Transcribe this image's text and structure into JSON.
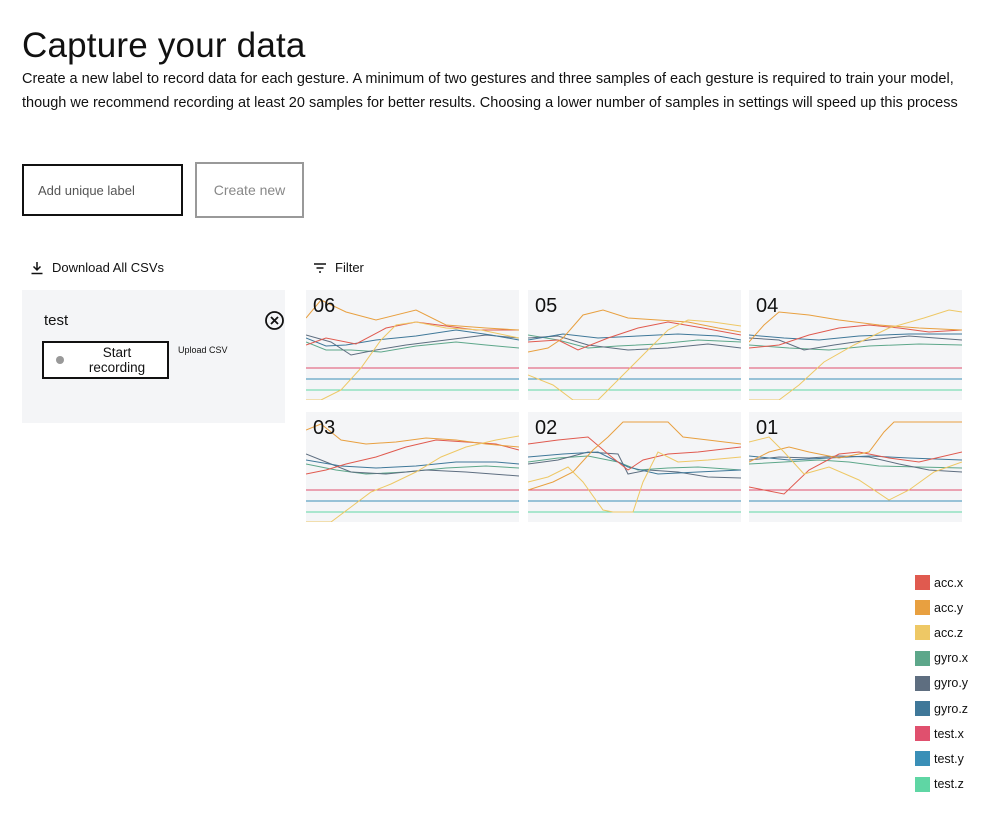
{
  "header": {
    "title": "Capture your data",
    "intro": "Create a new label to record data for each gesture. A minimum of two gestures and three samples of each gesture is required to train your model, though we recommend recording at least 20 samples for better results. Choosing a lower number of samples in settings will speed up this process"
  },
  "form": {
    "placeholder": "Add unique label",
    "create_label": "Create new"
  },
  "toolbar": {
    "download_label": "Download All CSVs",
    "download_icon": "download-icon",
    "filter_label": "Filter",
    "filter_icon": "filter-icon"
  },
  "gesture": {
    "name": "test",
    "remove_icon": "close-circle-icon",
    "record_label": "Start recording",
    "upload_label": "Upload CSV"
  },
  "samples": [
    {
      "id": "06"
    },
    {
      "id": "05"
    },
    {
      "id": "04"
    },
    {
      "id": "03"
    },
    {
      "id": "02"
    },
    {
      "id": "01"
    }
  ],
  "legend": [
    {
      "label": "acc.x",
      "color": "#e05a4f"
    },
    {
      "label": "acc.y",
      "color": "#e8a040"
    },
    {
      "label": "acc.z",
      "color": "#eec865"
    },
    {
      "label": "gyro.x",
      "color": "#5da78a"
    },
    {
      "label": "gyro.y",
      "color": "#5e6e80"
    },
    {
      "label": "gyro.z",
      "color": "#3f7899"
    },
    {
      "label": "test.x",
      "color": "#e0506e"
    },
    {
      "label": "test.y",
      "color": "#3a8fb7"
    },
    {
      "label": "test.z",
      "color": "#5fd6a4"
    }
  ]
}
